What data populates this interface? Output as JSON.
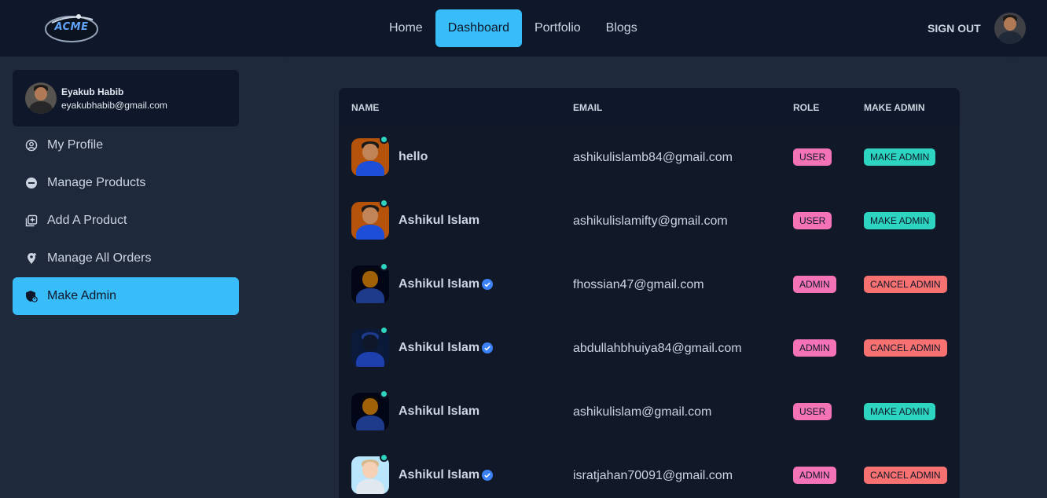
{
  "header": {
    "logo_text": "ACME",
    "nav": [
      "Home",
      "Dashboard",
      "Portfolio",
      "Blogs"
    ],
    "active_nav": "Dashboard",
    "sign_out": "SIGN OUT"
  },
  "colors": {
    "accent": "#38bdf8",
    "role_badge": "#f472b6",
    "make_admin": "#2dd4bf",
    "cancel_admin": "#f87171",
    "online": "#2dd4bf",
    "verified": "#3b82f6"
  },
  "sidebar": {
    "user": {
      "name": "Eyakub Habib",
      "email": "eyakubhabib@gmail.com"
    },
    "items": [
      {
        "label": "My Profile",
        "icon": "user-circle-icon"
      },
      {
        "label": "Manage Products",
        "icon": "minus-circle-icon"
      },
      {
        "label": "Add A Product",
        "icon": "add-box-icon"
      },
      {
        "label": "Manage All Orders",
        "icon": "location-pin-icon"
      },
      {
        "label": "Make Admin",
        "icon": "shield-user-icon",
        "active": true
      }
    ]
  },
  "table": {
    "columns": [
      "NAME",
      "EMAIL",
      "ROLE",
      "MAKE ADMIN"
    ],
    "rows": [
      {
        "name": "hello",
        "verified": false,
        "email": "ashikulislamb84@gmail.com",
        "role": "USER",
        "action": "MAKE ADMIN"
      },
      {
        "name": "Ashikul Islam",
        "verified": false,
        "email": "ashikulislamifty@gmail.com",
        "role": "USER",
        "action": "MAKE ADMIN"
      },
      {
        "name": "Ashikul Islam",
        "verified": true,
        "email": "fhossian47@gmail.com",
        "role": "ADMIN",
        "action": "CANCEL ADMIN"
      },
      {
        "name": "Ashikul Islam",
        "verified": true,
        "email": "abdullahbhuiya84@gmail.com",
        "role": "ADMIN",
        "action": "CANCEL ADMIN"
      },
      {
        "name": "Ashikul Islam",
        "verified": false,
        "email": "ashikulislam@gmail.com",
        "role": "USER",
        "action": "MAKE ADMIN"
      },
      {
        "name": "Ashikul Islam",
        "verified": true,
        "email": "isratjahan70091@gmail.com",
        "role": "ADMIN",
        "action": "CANCEL ADMIN"
      }
    ]
  }
}
